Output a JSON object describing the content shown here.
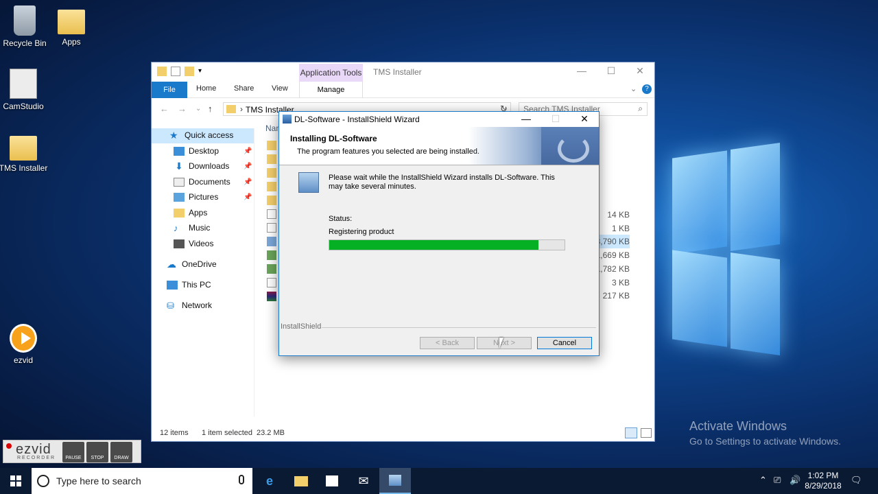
{
  "desktop": {
    "icons": [
      {
        "label": "Recycle Bin"
      },
      {
        "label": "Apps"
      },
      {
        "label": "CamStudio"
      },
      {
        "label": "TMS Installer"
      },
      {
        "label": "ezvid"
      }
    ],
    "watermark": {
      "line1": "Activate Windows",
      "line2": "Go to Settings to activate Windows."
    }
  },
  "explorer": {
    "context_tab": "Application Tools",
    "title": "TMS Installer",
    "ribbon_tabs": [
      "File",
      "Home",
      "Share",
      "View",
      "Manage"
    ],
    "address": "TMS Installer",
    "search_placeholder": "Search TMS Installer",
    "column_name": "Nam",
    "nav": {
      "quick_access": "Quick access",
      "items": [
        "Desktop",
        "Downloads",
        "Documents",
        "Pictures",
        "Apps",
        "Music",
        "Videos"
      ],
      "onedrive": "OneDrive",
      "this_pc": "This PC",
      "network": "Network"
    },
    "sizes": [
      "14 KB",
      "1 KB",
      "23,790 KB",
      "1,669 KB",
      "1,782 KB",
      "3 KB",
      "217 KB"
    ],
    "status": {
      "count": "12 items",
      "selected": "1 item selected",
      "size": "23.2 MB"
    }
  },
  "dialog": {
    "title": "DL-Software - InstallShield Wizard",
    "heading": "Installing DL-Software",
    "subheading": "The program features you selected are being installed.",
    "message": "Please wait while the InstallShield Wizard installs DL-Software. This may take several minutes.",
    "status_label": "Status:",
    "status_value": "Registering product",
    "progress": 0.89,
    "brand": "InstallShield",
    "buttons": {
      "back": "< Back",
      "next": "Next >",
      "cancel": "Cancel"
    }
  },
  "ezvid": {
    "logo": "ezvid",
    "sub": "RECORDER",
    "buttons": [
      "PAUSE",
      "STOP",
      "DRAW"
    ]
  },
  "taskbar": {
    "search_placeholder": "Type here to search",
    "time": "1:02 PM",
    "date": "8/29/2018"
  }
}
